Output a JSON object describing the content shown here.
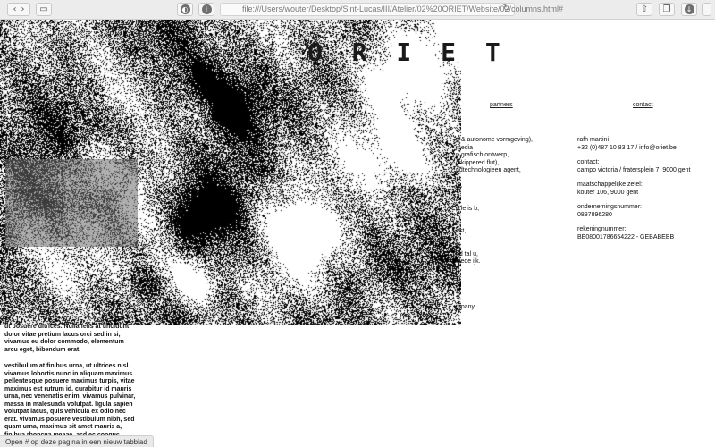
{
  "browser": {
    "url": "file:///Users/wouter/Desktop/Sint-Lucas/III/Atelier/02%20ORIET/Website/02/columns.html#",
    "status_text": "Open # op deze pagina in een nieuw tabblad"
  },
  "site": {
    "logo": "O R I E T",
    "nav": {
      "left": "partners",
      "right": "contact"
    },
    "contact": {
      "col_lines": [
        "rafh martini",
        "+32 (0)487 10 83 17 / info@oriet.be"
      ],
      "address_title": "contact:",
      "address": "campo victoria / fratersplein 7, 9000 gent",
      "seat_title": "maatschappelijke zetel:",
      "seat": "kouter 106, 9000 gent",
      "company_title": "ondernemingsnummer:",
      "company": "0897896280",
      "bank_title": "rekeningnummer:",
      "bank": "BE08001786654222 - GEBABEBB"
    },
    "middle_fragments": [
      "u & autonome vormgeving),",
      "media",
      "n grafisch ontwerp,",
      "(skippered flut),",
      "ndtechnologieen agent,",
      "",
      "ry,",
      "",
      "",
      "p le is b,",
      "",
      "s,",
      "est,",
      "",
      "r,",
      "pd tal u,",
      "stede ijk.",
      "",
      "",
      "s,",
      "",
      "",
      "mpany,"
    ],
    "left_paragraphs": [
      "ut posuere ultrices. Nulla felis at tincidunt dolor vitae pretium lacus orci sed in si, vivamus eu dolor commodo, elementum arcu eget, bibendum erat.",
      "vestibulum at finibus urna, ut ultrices nisl. vivamus lobortis nunc in aliquam maximus. pellentesque posuere maximus turpis, vitae maximus est rutrum id. curabitur id mauris urna, nec venenatis enim. vivamus pulvinar, massa in malesuada volutpat. ligula sapien volutpat lacus, quis vehicula ex odio nec erat. vivamus posuere vestibulum nibh, sed quam urna, maximus sit amet mauris a, finibus rhoncus massa. sed ac congue lacus."
    ]
  },
  "colors": {
    "toolbar_bg": "#ececec",
    "page_bg": "#ffffff",
    "ink": "#111111"
  },
  "icons": [
    "back-icon",
    "forward-icon",
    "sidebar-icon",
    "privacy-report-icon",
    "shield-icon",
    "reload-icon",
    "share-icon",
    "tabs-icon",
    "downloads-icon"
  ]
}
